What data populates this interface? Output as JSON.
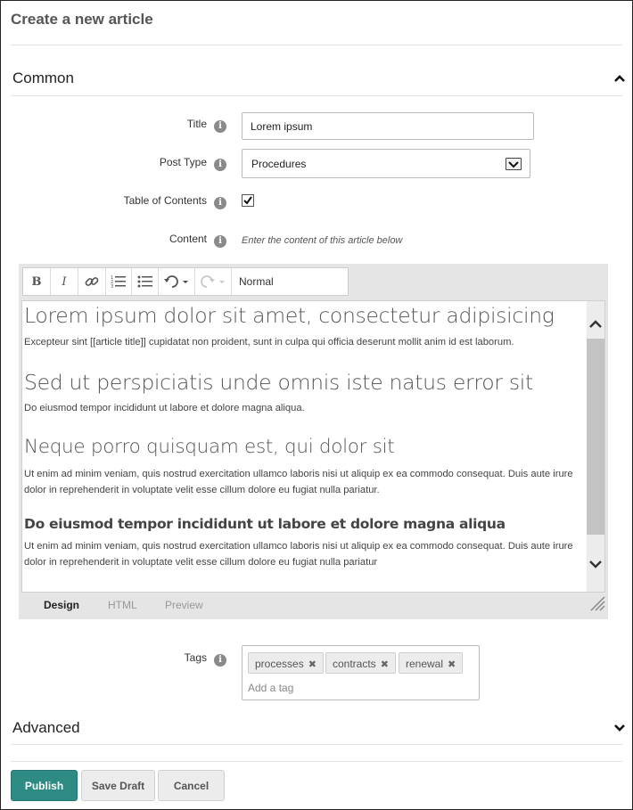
{
  "page": {
    "title": "Create a new article"
  },
  "sections": {
    "common": {
      "label": "Common",
      "expanded": true
    },
    "advanced": {
      "label": "Advanced",
      "expanded": false
    }
  },
  "form": {
    "title": {
      "label": "Title",
      "value": "Lorem ipsum"
    },
    "post_type": {
      "label": "Post Type",
      "value": "Procedures"
    },
    "toc": {
      "label": "Table of Contents",
      "checked": true
    },
    "content": {
      "label": "Content",
      "hint": "Enter the content of this article below"
    }
  },
  "editor": {
    "toolbar": {
      "bold": "B",
      "italic": "I",
      "format": "Normal"
    },
    "content": {
      "h1": "Lorem ipsum dolor sit amet, consectetur adipisicing",
      "p1": "Excepteur sint [[article title]] cupidatat non proident, sunt in culpa qui officia deserunt mollit anim id est laborum.",
      "h2": "Sed ut perspiciatis unde omnis iste natus error sit",
      "p2": "Do eiusmod tempor incididunt ut labore et dolore magna aliqua.",
      "h3": "Neque porro quisquam est, qui dolor sit",
      "p3": "Ut enim ad minim veniam, quis nostrud exercitation ullamco laboris nisi ut aliquip ex ea commodo consequat. Duis aute irure dolor in reprehenderit in voluptate velit esse cillum dolore eu fugiat nulla pariatur.",
      "h4": "Do eiusmod tempor incididunt ut labore et dolore magna aliqua",
      "p4": "Ut enim ad minim veniam, quis nostrud exercitation ullamco laboris nisi ut aliquip ex ea commodo consequat. Duis aute irure dolor in reprehenderit in voluptate velit esse cillum dolore eu fugiat nulla pariatur"
    },
    "modes": {
      "design": "Design",
      "html": "HTML",
      "preview": "Preview",
      "active": "Design"
    }
  },
  "tags": {
    "label": "Tags",
    "items": [
      "processes",
      "contracts",
      "renewal"
    ],
    "remove_glyph": "✖",
    "placeholder": "Add a tag"
  },
  "buttons": {
    "publish": "Publish",
    "save_draft": "Save Draft",
    "cancel": "Cancel"
  },
  "colors": {
    "primary": "#2e8b84",
    "info_icon": "#8a8a8a"
  },
  "icons": {
    "info": "i",
    "chevron_up": "chevron-up-icon",
    "chevron_down": "chevron-down-icon"
  }
}
